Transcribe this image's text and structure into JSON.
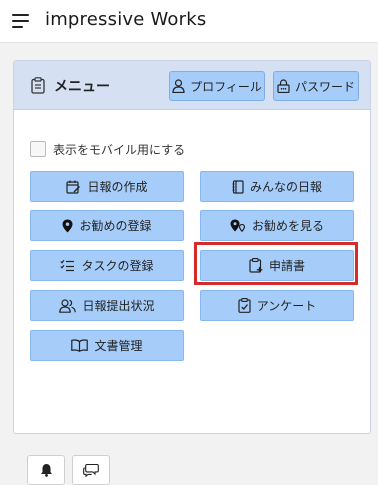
{
  "app": {
    "title": "impressive Works"
  },
  "panel": {
    "title": "メニュー",
    "profile_label": "プロフィール",
    "password_label": "パスワード",
    "mobile_toggle_label": "表示をモバイル用にする",
    "mobile_toggle_checked": false
  },
  "menu": {
    "create_diary": "日報の作成",
    "everyones_diary": "みんなの日報",
    "register_recommend": "お勧めの登録",
    "view_recommend": "お勧めを見る",
    "register_task": "タスクの登録",
    "application": "申請書",
    "diary_submission_status": "日報提出状況",
    "survey": "アンケート",
    "document_management": "文書管理"
  },
  "colors": {
    "button_bg": "#a6cdfa",
    "header_bg": "#d6e0f3",
    "highlight": "#d62b2b"
  }
}
